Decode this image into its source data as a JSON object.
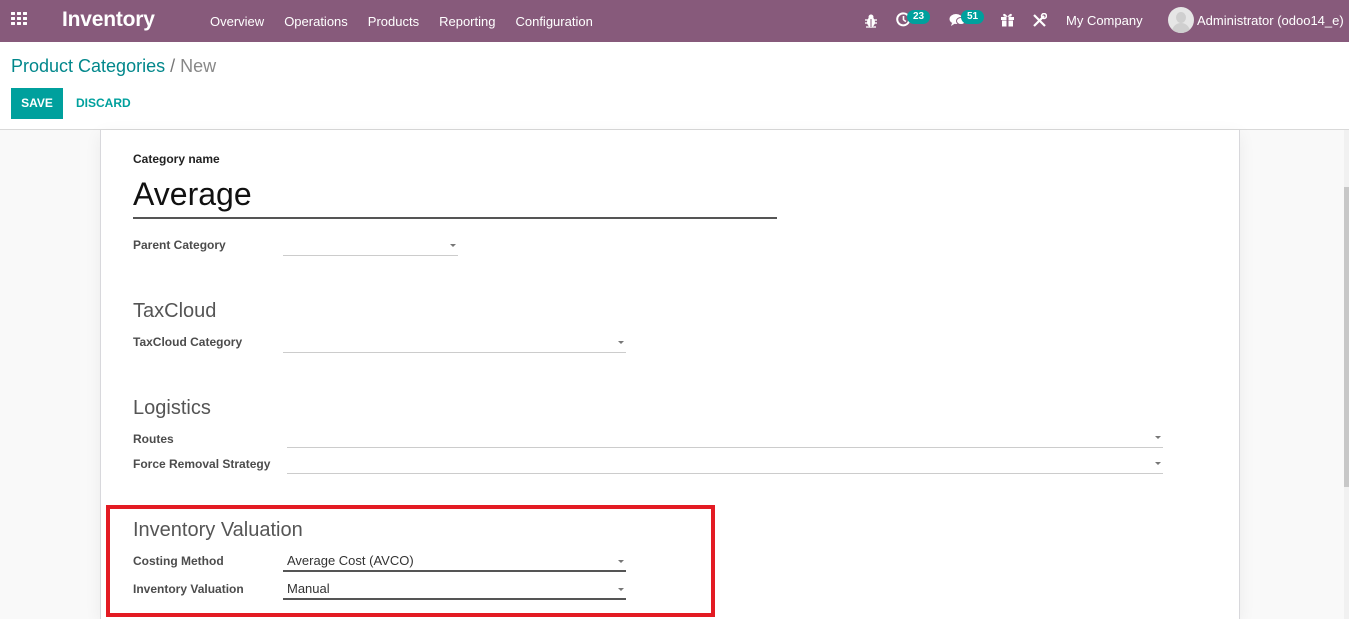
{
  "navbar": {
    "app_title": "Inventory",
    "menu": [
      "Overview",
      "Operations",
      "Products",
      "Reporting",
      "Configuration"
    ],
    "systray": {
      "debug_icon": "bug-icon",
      "activity_icon": "clock-icon",
      "activity_count": "23",
      "messages_icon": "chat-icon",
      "messages_count": "51",
      "gift_icon": "gift-icon",
      "tools_icon": "tools-icon",
      "company": "My Company",
      "user": "Administrator (odoo14_e)"
    },
    "colors": {
      "brand": "#875a7b",
      "badge": "#00a09d"
    }
  },
  "control_panel": {
    "breadcrumb": {
      "parent": "Product Categories",
      "separator": "/",
      "current": "New"
    },
    "save_label": "SAVE",
    "discard_label": "DISCARD"
  },
  "form": {
    "name_label": "Category name",
    "name_value": "Average",
    "parent_category": {
      "label": "Parent Category",
      "value": ""
    },
    "taxcloud": {
      "title": "TaxCloud",
      "category": {
        "label": "TaxCloud Category",
        "value": ""
      }
    },
    "logistics": {
      "title": "Logistics",
      "routes": {
        "label": "Routes",
        "value": ""
      },
      "removal_strategy": {
        "label": "Force Removal Strategy",
        "value": ""
      }
    },
    "inventory_valuation": {
      "title": "Inventory Valuation",
      "costing_method": {
        "label": "Costing Method",
        "value": "Average Cost (AVCO)"
      },
      "valuation": {
        "label": "Inventory Valuation",
        "value": "Manual"
      },
      "highlight_color": "#e31b23"
    }
  }
}
